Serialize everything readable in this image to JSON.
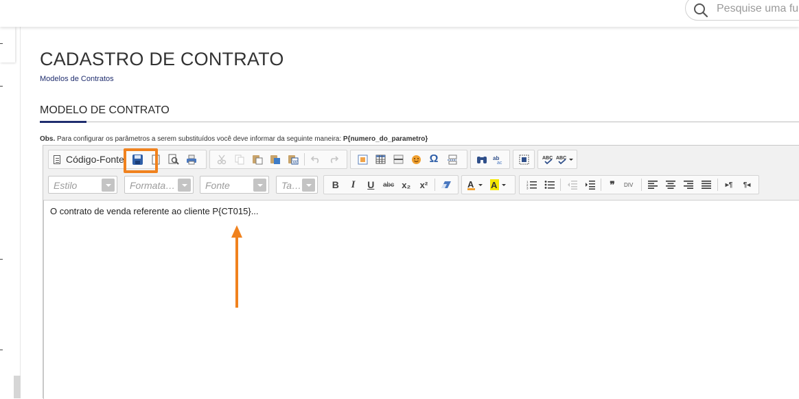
{
  "header": {
    "search_placeholder": "Pesquise uma fu"
  },
  "page": {
    "title": "CADASTRO DE CONTRATO",
    "breadcrumb": "Modelos de Contratos",
    "section_title": "MODELO DE CONTRATO",
    "obs_label": "Obs.",
    "obs_text": " Para configurar os parâmetros a serem substituídos você deve informar da seguinte maneira: ",
    "obs_param": "P{numero_do_parametro}"
  },
  "editor": {
    "source_label": "Código-Fonte",
    "combos": {
      "style": "Estilo",
      "format": "Formata…",
      "font": "Fonte",
      "size": "Ta…"
    },
    "glyphs": {
      "bold": "B",
      "italic": "I",
      "underline": "U",
      "strike": "abc",
      "subscript": "x₂",
      "superscript": "x²",
      "omega": "Ω",
      "blockquote": "❞",
      "ltr": "▸¶",
      "rtl": "¶◂"
    },
    "content": "O contrato de venda referente ao cliente P{CT015}..."
  },
  "colors": {
    "accent_navy": "#1f2d6e",
    "annotation_orange": "#f0821e",
    "save_blue": "#2f5fa8"
  }
}
